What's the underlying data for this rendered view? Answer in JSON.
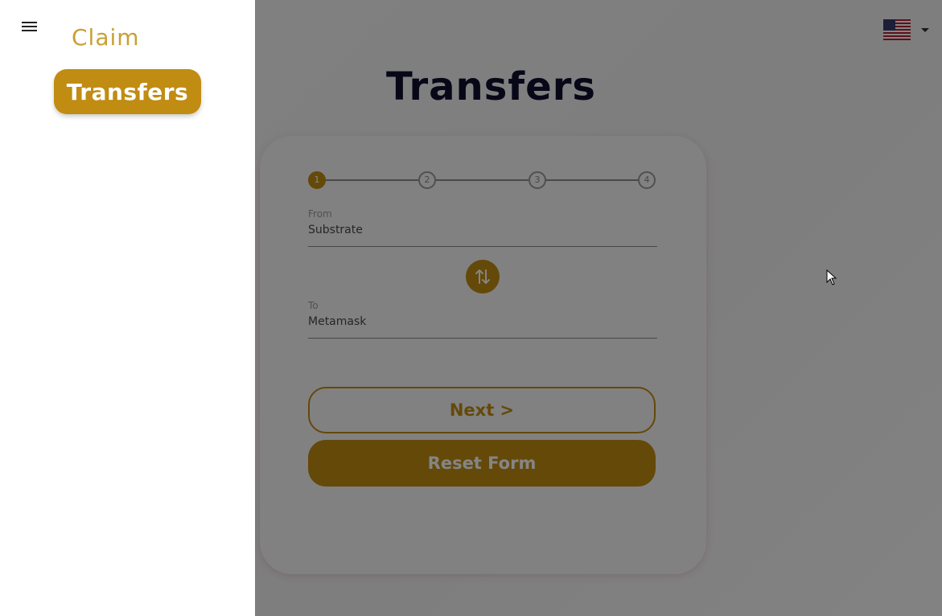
{
  "page": {
    "title": "Transfers"
  },
  "stepper": {
    "steps": [
      "1",
      "2",
      "3",
      "4"
    ],
    "active_step": 1
  },
  "form": {
    "from": {
      "label": "From",
      "value": "Substrate"
    },
    "to": {
      "label": "To",
      "value": "Metamask"
    },
    "next_label": "Next >",
    "reset_label": "Reset Form"
  },
  "language": {
    "selected_icon": "us-flag-icon"
  },
  "drawer": {
    "menu_icon": "menu-icon",
    "items": [
      {
        "label": "Claim",
        "active": false
      },
      {
        "label": "Transfers",
        "active": true
      }
    ]
  },
  "colors": {
    "accent": "#c08c12",
    "claim_text": "#c9a034",
    "title": "#0f0f2d",
    "overlay": "rgba(0,0,0,0.48)"
  }
}
